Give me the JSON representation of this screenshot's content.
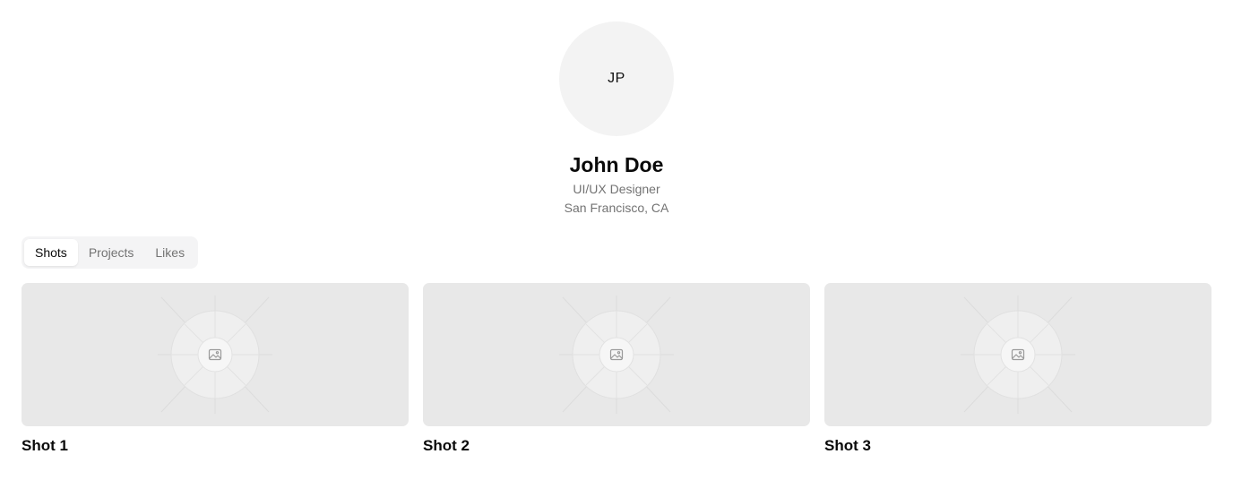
{
  "profile": {
    "initials": "JP",
    "name": "John Doe",
    "role": "UI/UX Designer",
    "location": "San Francisco, CA"
  },
  "tabs": [
    {
      "label": "Shots",
      "active": true
    },
    {
      "label": "Projects",
      "active": false
    },
    {
      "label": "Likes",
      "active": false
    }
  ],
  "shots": [
    {
      "title": "Shot 1",
      "icon": "image-placeholder-icon"
    },
    {
      "title": "Shot 2",
      "icon": "image-placeholder-icon"
    },
    {
      "title": "Shot 3",
      "icon": "image-placeholder-icon"
    }
  ],
  "colors": {
    "placeholder_bg": "#e8e8e8",
    "muted_text": "#737373",
    "tab_bg": "#f4f4f5"
  }
}
